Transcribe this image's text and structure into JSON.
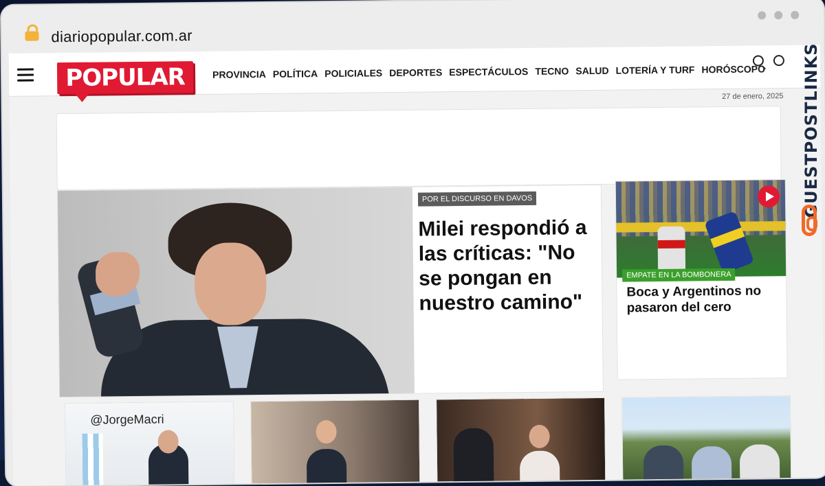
{
  "browser": {
    "url": "diariopopular.com.ar"
  },
  "site": {
    "logo_text": "POPULAR",
    "date": "27 de enero, 2025",
    "menu": [
      "PROVINCIA",
      "POLÍTICA",
      "POLICIALES",
      "DEPORTES",
      "ESPECTÁCULOS",
      "TECNO",
      "SALUD",
      "LOTERÍA Y TURF",
      "HORÓSCOPO"
    ],
    "icons": {
      "menu": "hamburger-icon",
      "search": "search-icon",
      "user": "user-icon"
    }
  },
  "hero": {
    "kicker": "POR EL DISCURSO EN DAVOS",
    "title": "Milei respondió a las críticas: \"No se pongan en nuestro camino\""
  },
  "side_story": {
    "kicker": "EMPATE EN LA BOMBONERA",
    "title": "Boca y Argentinos no pasaron del cero",
    "icon": "play-icon"
  },
  "cards": [
    {
      "image_text": "@JorgeMacri"
    },
    {},
    {},
    {}
  ],
  "watermark": {
    "text": "GUESTPOSTLINKS"
  },
  "colors": {
    "brand_red": "#e01a32",
    "kicker_gray": "#5b5b5b",
    "kicker_green": "#3aa02b",
    "watermark_orange": "#f06a2b"
  }
}
